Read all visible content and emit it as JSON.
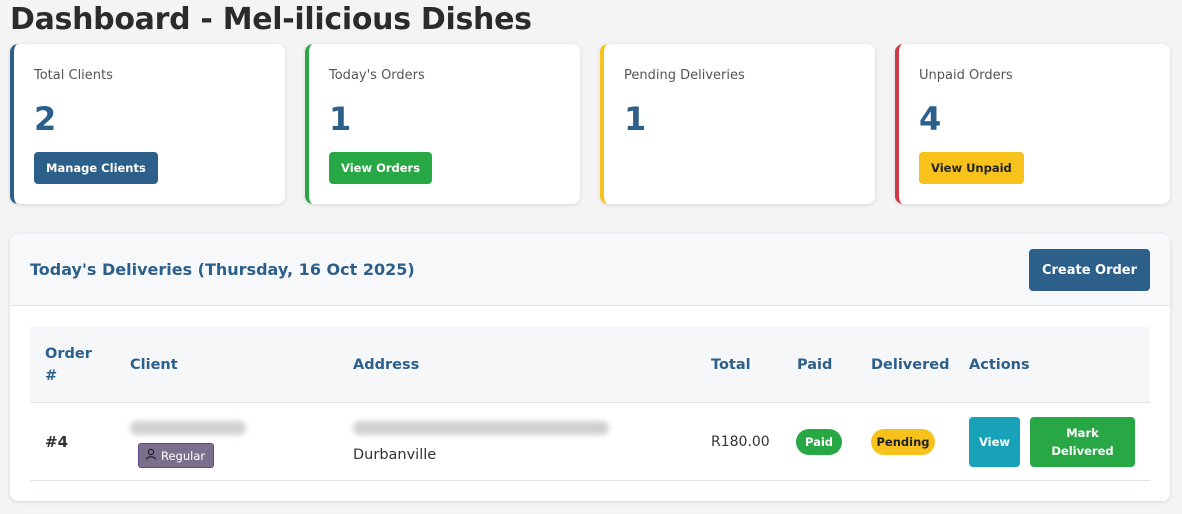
{
  "page": {
    "title": "Dashboard - Mel-ilicious Dishes"
  },
  "stats": [
    {
      "label": "Total Clients",
      "value": "2",
      "button": "Manage Clients",
      "accent": "#2d5f8b"
    },
    {
      "label": "Today's Orders",
      "value": "1",
      "button": "View Orders",
      "accent": "#28a745"
    },
    {
      "label": "Pending Deliveries",
      "value": "1",
      "accent": "#f6c21b"
    },
    {
      "label": "Unpaid Orders",
      "value": "4",
      "button": "View Unpaid",
      "accent": "#cf3c47"
    }
  ],
  "deliveries": {
    "title": "Today's Deliveries (Thursday, 16 Oct 2025)",
    "create_button": "Create Order",
    "columns": [
      "Order #",
      "Client",
      "Address",
      "Total",
      "Paid",
      "Delivered",
      "Actions"
    ],
    "rows": [
      {
        "order": "#4",
        "client_badge": "Regular",
        "address_line2": "Durbanville",
        "total": "R180.00",
        "paid": "Paid",
        "delivered": "Pending",
        "view_button": "View",
        "mark_button": "Mark Delivered"
      }
    ]
  }
}
